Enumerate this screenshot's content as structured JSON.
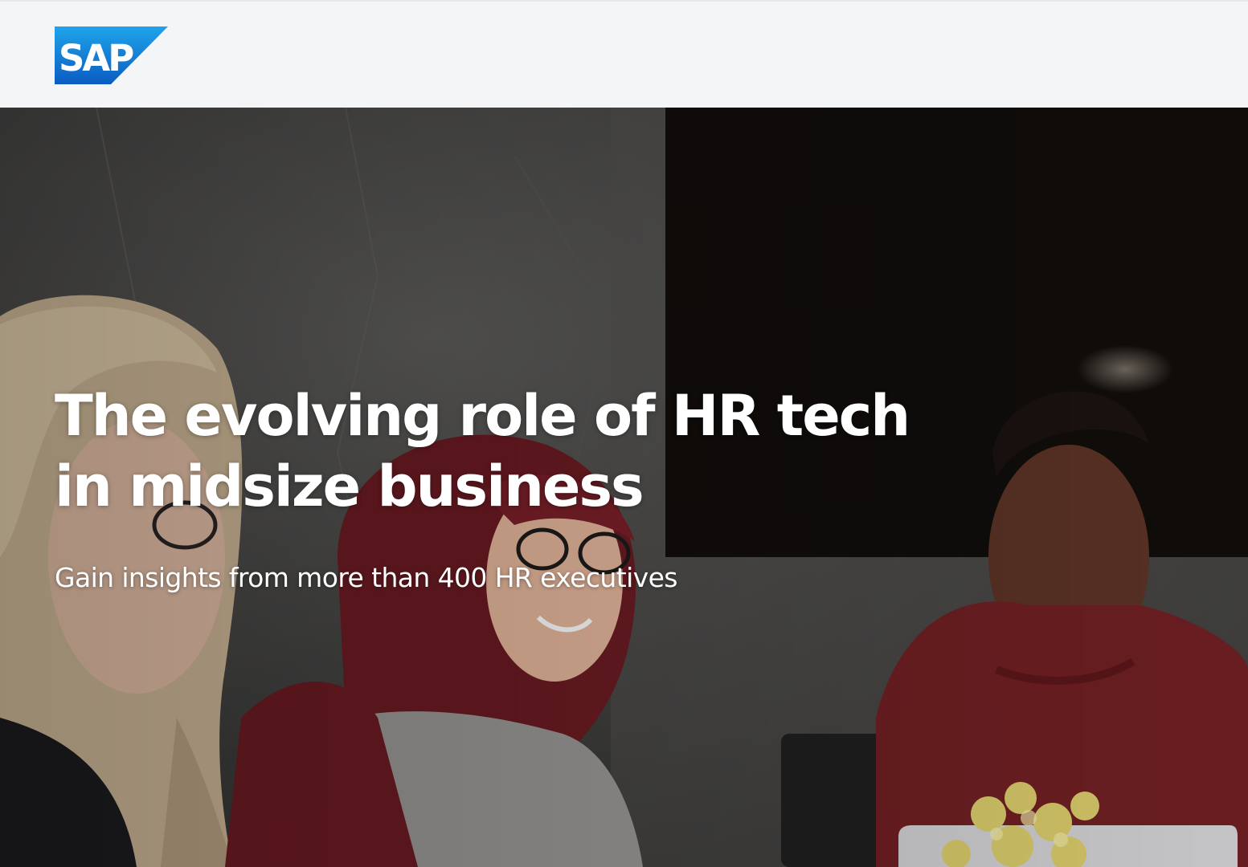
{
  "header": {
    "logo_text": "SAP",
    "logo_icon": "sap-logo",
    "brand_colors": [
      "#1a95e0",
      "#0a56b8"
    ]
  },
  "hero": {
    "headline": "The evolving role of HR tech in midsize business",
    "subheadline": "Gain insights from more than 400 HR executives",
    "image_icon": "team-meeting-photo"
  }
}
